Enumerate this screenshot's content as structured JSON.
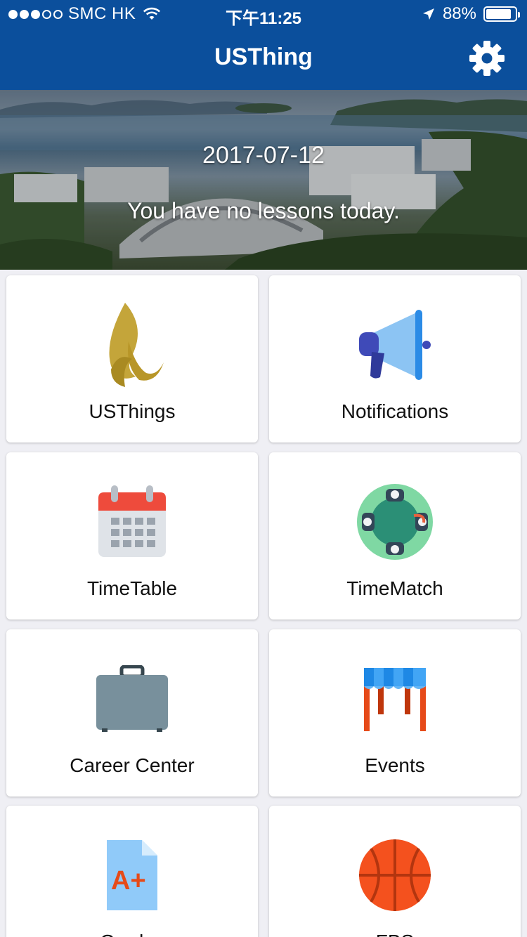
{
  "status_bar": {
    "carrier": "SMC HK",
    "time": "下午11:25",
    "battery": "88%",
    "battery_level": 0.88
  },
  "nav": {
    "title": "USThing",
    "settings_icon": "gear-icon"
  },
  "hero": {
    "date": "2017-07-12",
    "message": "You have no lessons today."
  },
  "tiles": [
    {
      "label": "USThings",
      "icon": "flame-logo-icon"
    },
    {
      "label": "Notifications",
      "icon": "megaphone-icon"
    },
    {
      "label": "TimeTable",
      "icon": "calendar-icon"
    },
    {
      "label": "TimeMatch",
      "icon": "meeting-table-icon"
    },
    {
      "label": "Career Center",
      "icon": "briefcase-icon"
    },
    {
      "label": "Events",
      "icon": "market-stall-icon"
    },
    {
      "label": "Grades",
      "icon": "grade-document-icon"
    },
    {
      "label": "FBS",
      "icon": "basketball-icon"
    }
  ],
  "colors": {
    "nav_bar": "#0b4f9c",
    "background": "#efeff4"
  }
}
